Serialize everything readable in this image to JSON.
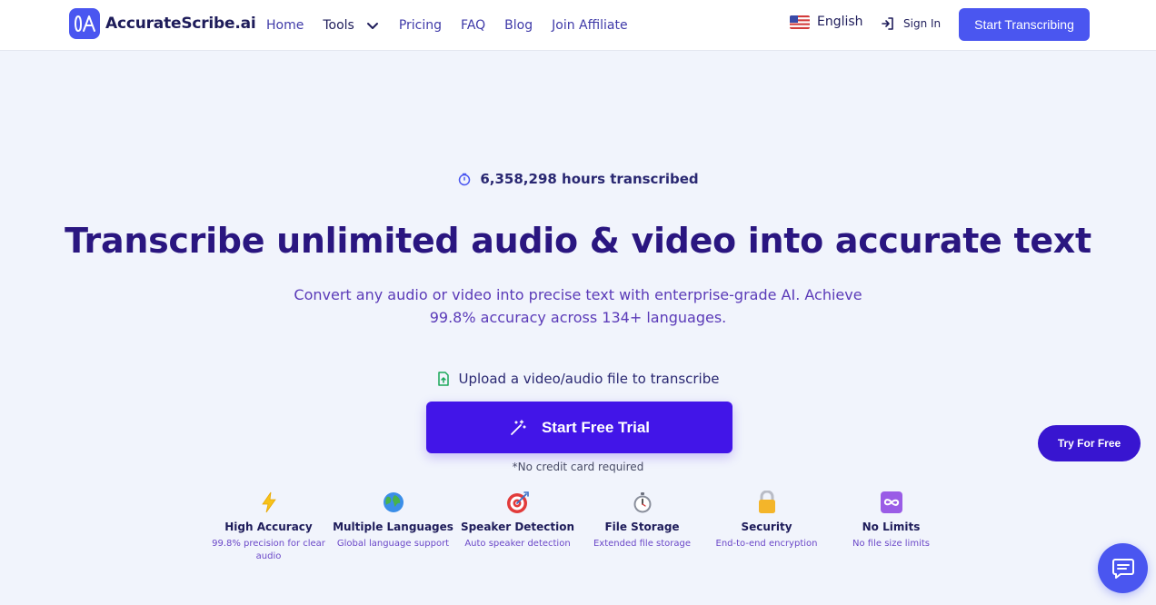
{
  "nav": {
    "logo_text": "AccurateScribe.ai",
    "links": [
      "Home",
      "Tools",
      "Pricing",
      "FAQ",
      "Blog",
      "Join Affiliate"
    ],
    "language": "English",
    "signin": "Sign In",
    "cta": "Start Transcribing"
  },
  "hero": {
    "counter": "6,358,298 hours transcribed",
    "headline": "Transcribe unlimited audio & video into accurate text",
    "subtitle": "Convert any audio or video into precise text with enterprise-grade AI. Achieve 99.8% accuracy across 134+ languages.",
    "upload_label": "Upload a video/audio file to transcribe",
    "trial_button": "Start Free Trial",
    "no_card": "*No credit card required"
  },
  "features": [
    {
      "title": "High Accuracy",
      "desc": "99.8% precision for clear audio",
      "icon": "lightning-icon"
    },
    {
      "title": "Multiple Languages",
      "desc": "Global language support",
      "icon": "globe-icon"
    },
    {
      "title": "Speaker Detection",
      "desc": "Auto speaker detection",
      "icon": "target-icon"
    },
    {
      "title": "File Storage",
      "desc": "Extended file storage",
      "icon": "stopwatch-icon"
    },
    {
      "title": "Security",
      "desc": "End-to-end encryption",
      "icon": "lock-icon"
    },
    {
      "title": "No Limits",
      "desc": "No file size limits",
      "icon": "infinity-icon"
    }
  ],
  "floating": {
    "try_free": "Try For Free"
  },
  "colors": {
    "brand": "#4a56f0",
    "trial_button": "#4215e8",
    "headline": "#2a1680",
    "background": "#f1f4fc"
  }
}
